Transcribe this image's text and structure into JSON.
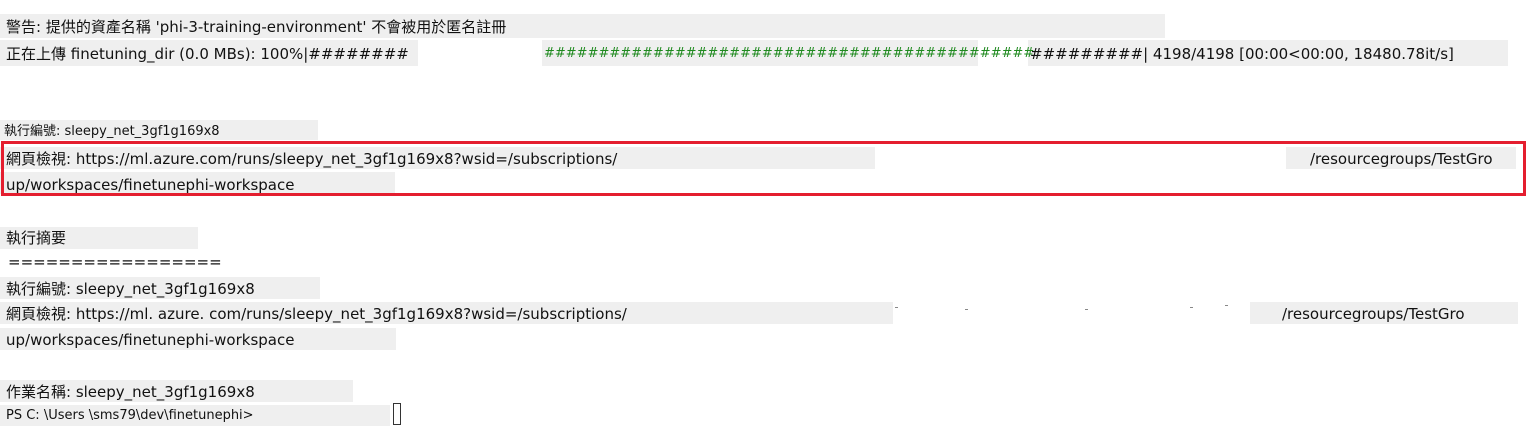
{
  "terminal": {
    "warning": "警告: 提供的資產名稱 'phi-3-training-environment' 不會被用於匿名註冊",
    "upload": {
      "prefix": "正在上傳 finetuning_dir (0.0 MBs): 100%|########",
      "middle": "#############################################",
      "suffix": "#########| 4198/4198 [00:00<00:00, 18480.78it/s]"
    },
    "run_id_top": "執行編號: sleepy_net_3gf1g169x8",
    "web_view_top": {
      "line1_left": "網頁檢視: https://ml.azure.com/runs/sleepy_net_3gf1g169x8?wsid=/subscriptions/",
      "line1_right": "/resourcegroups/TestGro",
      "line2": "up/workspaces/finetunephi-workspace"
    },
    "summary_title": "執行摘要",
    "separator": "=================",
    "run_id": "執行編號: sleepy_net_3gf1g169x8",
    "web_view": {
      "line1_left": "網頁檢視: https://ml. azure. com/runs/sleepy_net_3gf1g169x8?wsid=/subscriptions/",
      "line1_right": "/resourcegroups/TestGro",
      "line2": "up/workspaces/finetunephi-workspace"
    },
    "job_name": "作業名稱: sleepy_net_3gf1g169x8",
    "prompt": "PS C: \\Users \\sms79\\dev\\finetunephi>"
  },
  "colors": {
    "highlight": "#e41e2f",
    "progress_green": "#1f8a1f",
    "line_bg": "#efefef"
  }
}
